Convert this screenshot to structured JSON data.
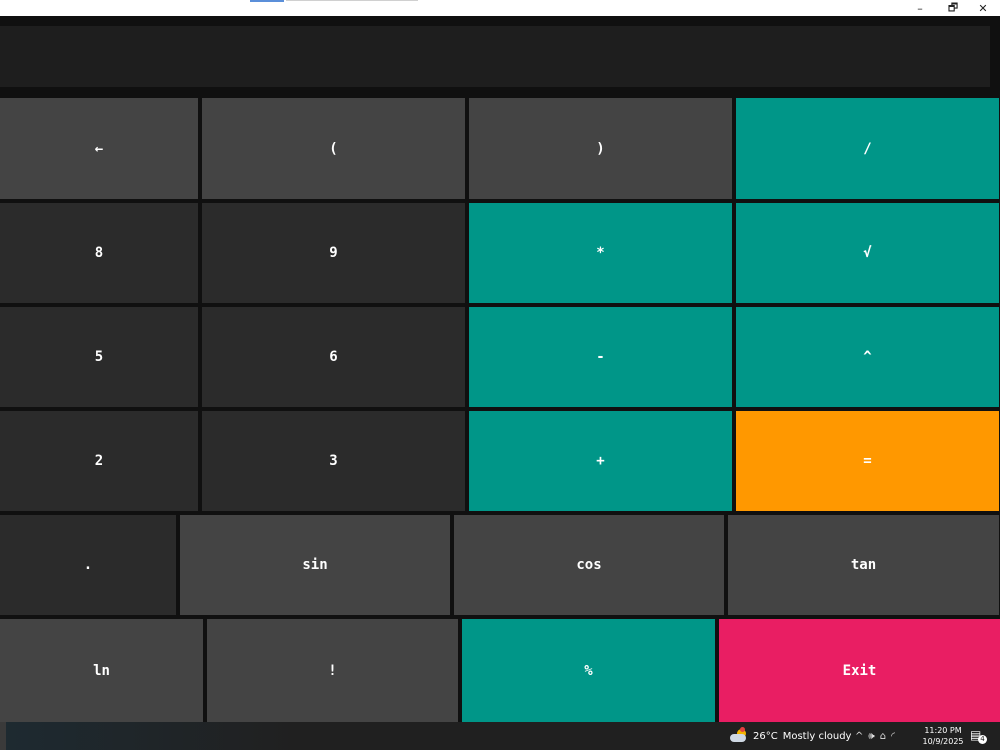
{
  "window": {
    "controls": {
      "minimize": "–",
      "maximize": "🗗",
      "close": "✕"
    }
  },
  "display": {
    "value": ""
  },
  "keys": {
    "backspace": "←",
    "lparen": "(",
    "rparen": ")",
    "divide": "/",
    "eight": "8",
    "nine": "9",
    "multiply": "*",
    "sqrt": "√",
    "five": "5",
    "six": "6",
    "minus": "-",
    "power": "^",
    "two": "2",
    "three": "3",
    "plus": "+",
    "equals": "=",
    "decimal": ".",
    "sin": "sin",
    "cos": "cos",
    "tan": "tan",
    "ln": "ln",
    "factorial": "!",
    "percent": "%",
    "exit": "Exit"
  },
  "colors": {
    "key_gray": "#444444",
    "key_dark": "#2b2b2b",
    "key_teal": "#009688",
    "key_orange": "#ff9800",
    "key_pink": "#e91e63"
  },
  "taskbar": {
    "weather_icon": "partly-cloudy-icon",
    "temperature": "26°C",
    "condition": "Mostly cloudy",
    "tray_chevron": "^",
    "volume_icon": "🕪",
    "battery_icon": "⌂",
    "wifi_icon": "◜",
    "time": "11:20 PM",
    "date": "10/9/2025",
    "notifications_count": "4"
  }
}
